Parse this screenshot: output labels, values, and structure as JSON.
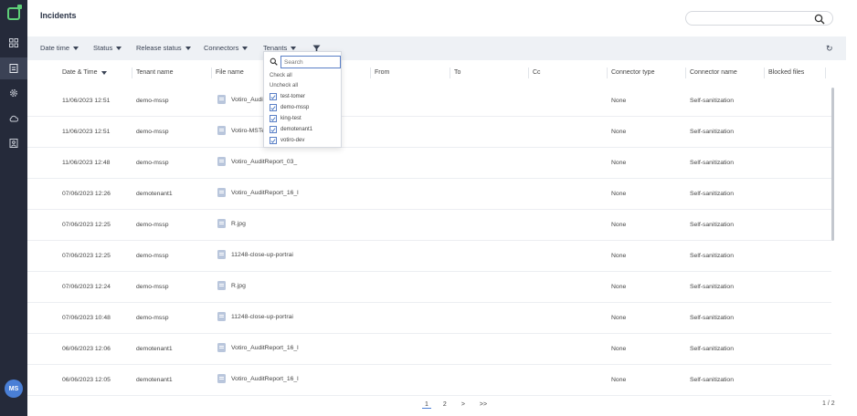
{
  "sidebar": {
    "avatar": "MS",
    "items": [
      {
        "icon": "dashboard-icon"
      },
      {
        "icon": "incidents-icon"
      },
      {
        "icon": "settings-icon"
      },
      {
        "icon": "cloud-icon"
      },
      {
        "icon": "reports-icon"
      }
    ]
  },
  "header": {
    "title": "Incidents",
    "search_placeholder": ""
  },
  "filters": {
    "items": [
      {
        "label": "Date time"
      },
      {
        "label": "Status"
      },
      {
        "label": "Release status"
      },
      {
        "label": "Connectors"
      },
      {
        "label": "Tenants"
      }
    ]
  },
  "tenants_dropdown": {
    "search_placeholder": "Search",
    "check_all": "Check all",
    "uncheck_all": "Uncheck all",
    "options": [
      {
        "label": "test-tomer",
        "checked": true
      },
      {
        "label": "demo-mssp",
        "checked": true
      },
      {
        "label": "king-test",
        "checked": true
      },
      {
        "label": "demotenant1",
        "checked": true
      },
      {
        "label": "votiro-dev",
        "checked": true
      }
    ]
  },
  "table": {
    "columns": [
      "Date & Time",
      "Tenant name",
      "File name",
      "From",
      "To",
      "Cc",
      "Connector type",
      "Connector name",
      "Blocked files"
    ],
    "rows": [
      {
        "date": "11/06/2023 12:51",
        "tenant": "demo-mssp",
        "file": "Votiro_AuditR",
        "type": "None",
        "connector": "Self-sanitization"
      },
      {
        "date": "11/06/2023 12:51",
        "tenant": "demo-mssp",
        "file": "Votiro-MSTe",
        "type": "None",
        "connector": "Self-sanitization"
      },
      {
        "date": "11/06/2023 12:48",
        "tenant": "demo-mssp",
        "file": "Votiro_AuditReport_03_",
        "type": "None",
        "connector": "Self-sanitization"
      },
      {
        "date": "07/06/2023 12:26",
        "tenant": "demotenant1",
        "file": "Votiro_AuditReport_16_l",
        "type": "None",
        "connector": "Self-sanitization"
      },
      {
        "date": "07/06/2023 12:25",
        "tenant": "demo-mssp",
        "file": "R.jpg",
        "type": "None",
        "connector": "Self-sanitization"
      },
      {
        "date": "07/06/2023 12:25",
        "tenant": "demo-mssp",
        "file": "11248-close-up-portrai",
        "type": "None",
        "connector": "Self-sanitization"
      },
      {
        "date": "07/06/2023 12:24",
        "tenant": "demo-mssp",
        "file": "R.jpg",
        "type": "None",
        "connector": "Self-sanitization"
      },
      {
        "date": "07/06/2023 10:48",
        "tenant": "demo-mssp",
        "file": "11248-close-up-portrai",
        "type": "None",
        "connector": "Self-sanitization"
      },
      {
        "date": "06/06/2023 12:06",
        "tenant": "demotenant1",
        "file": "Votiro_AuditReport_16_l",
        "type": "None",
        "connector": "Self-sanitization"
      },
      {
        "date": "06/06/2023 12:05",
        "tenant": "demotenant1",
        "file": "Votiro_AuditReport_16_l",
        "type": "None",
        "connector": "Self-sanitization"
      }
    ]
  },
  "pagination": {
    "pages": [
      "1",
      "2",
      ">",
      ">>"
    ],
    "count": "1 / 2"
  }
}
